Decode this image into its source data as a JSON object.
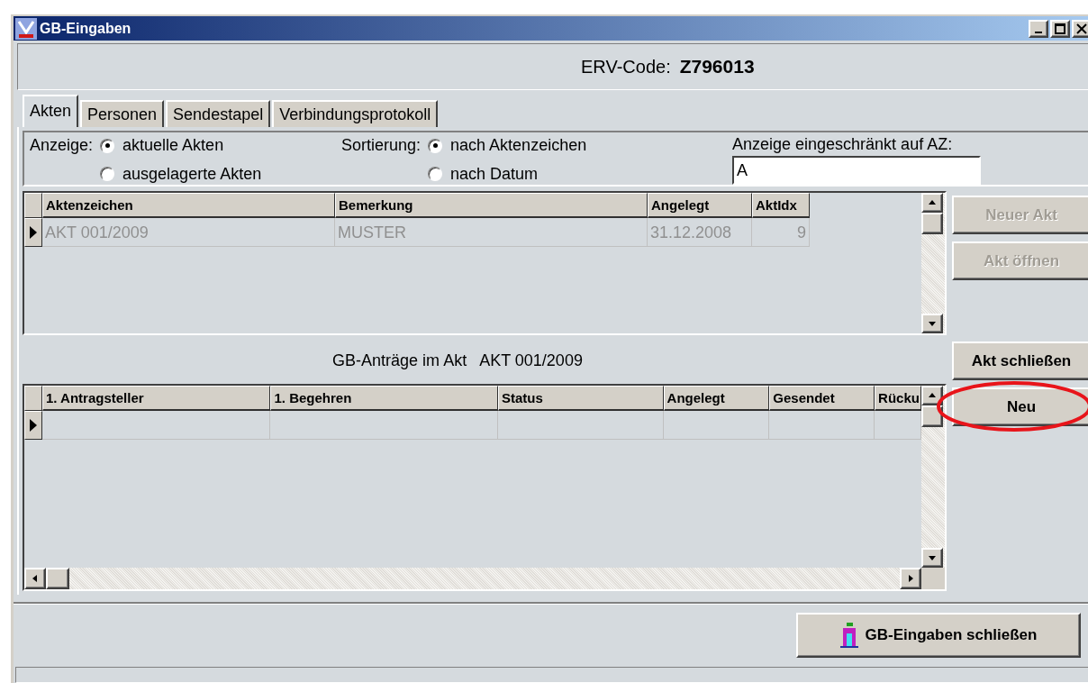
{
  "window": {
    "title": "GB-Eingaben"
  },
  "erv_code": {
    "label": "ERV-Code:",
    "value": "Z796013"
  },
  "tabs": [
    {
      "label": "Akten",
      "selected": true
    },
    {
      "label": "Personen",
      "selected": false
    },
    {
      "label": "Sendestapel",
      "selected": false
    },
    {
      "label": "Verbindungsprotokoll",
      "selected": false
    }
  ],
  "anzeige": {
    "label": "Anzeige:",
    "options": [
      {
        "label": "aktuelle Akten",
        "selected": true
      },
      {
        "label": "ausgelagerte Akten",
        "selected": false
      }
    ]
  },
  "sortierung": {
    "label": "Sortierung:",
    "options": [
      {
        "label": "nach Aktenzeichen",
        "selected": true
      },
      {
        "label": "nach Datum",
        "selected": false
      }
    ]
  },
  "az_filter": {
    "label": "Anzeige eingeschränkt auf AZ:",
    "value": "A"
  },
  "akten_table": {
    "columns": [
      "Aktenzeichen",
      "Bemerkung",
      "Angelegt",
      "AktIdx"
    ],
    "rows": [
      {
        "current": true,
        "disabled": true,
        "cells": [
          "AKT 001/2009",
          "MUSTER",
          "31.12.2008",
          "9"
        ]
      }
    ]
  },
  "side_buttons": [
    {
      "label": "Neuer Akt",
      "disabled": true,
      "highlighted": false
    },
    {
      "label": "Akt öffnen",
      "disabled": true,
      "highlighted": false
    },
    {
      "label": "Akt schließen",
      "disabled": false,
      "highlighted": false
    },
    {
      "label": "Neu",
      "disabled": false,
      "highlighted": true
    }
  ],
  "antraege_caption": {
    "label": "GB-Anträge im Akt",
    "akt": "AKT 001/2009"
  },
  "antraege_table": {
    "columns": [
      "1. Antragsteller",
      "1. Begehren",
      "Status",
      "Angelegt",
      "Gesendet",
      "Rücku"
    ],
    "rows": [
      {
        "current": true,
        "cells": []
      }
    ]
  },
  "close_button": {
    "label": "GB-Eingaben schließen"
  }
}
